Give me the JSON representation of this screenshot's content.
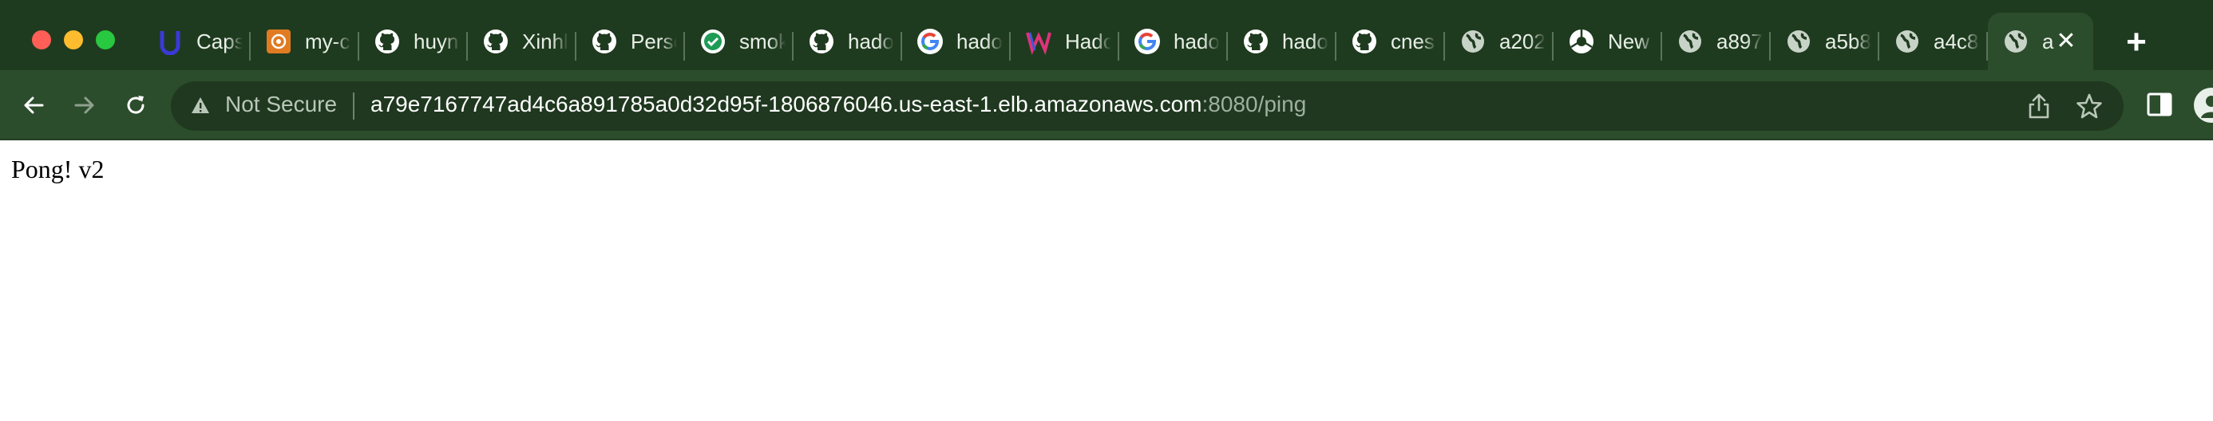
{
  "browser": {
    "tabs": [
      {
        "label": "Caps",
        "icon": "udacity-icon"
      },
      {
        "label": "my-c",
        "icon": "aws-orange-icon"
      },
      {
        "label": "huyn",
        "icon": "github-icon"
      },
      {
        "label": "Xinhl",
        "icon": "github-icon"
      },
      {
        "label": "Perso",
        "icon": "github-icon"
      },
      {
        "label": "smok",
        "icon": "green-check-icon"
      },
      {
        "label": "hado",
        "icon": "github-icon"
      },
      {
        "label": "hado",
        "icon": "google-icon"
      },
      {
        "label": "Hado",
        "icon": "w-logo-icon"
      },
      {
        "label": "hado",
        "icon": "google-icon"
      },
      {
        "label": "hado",
        "icon": "github-icon"
      },
      {
        "label": "cnes",
        "icon": "github-icon"
      },
      {
        "label": "a202",
        "icon": "globe-icon"
      },
      {
        "label": "New",
        "icon": "chrome-icon"
      },
      {
        "label": "a897",
        "icon": "globe-icon"
      },
      {
        "label": "a5b8",
        "icon": "globe-icon"
      },
      {
        "label": "a4c8",
        "icon": "globe-icon"
      }
    ],
    "active_tab": {
      "label": "a",
      "icon": "globe-icon"
    },
    "new_tab_label": "+",
    "close_label": "✕",
    "security_label": "Not Secure",
    "url_host": "a79e7167747ad4c6a891785a0d32d95f-1806876046.us-east-1.elb.amazonaws.com",
    "url_path": ":8080/ping",
    "colors": {
      "tabstrip": "#1f3b1f",
      "toolbar": "#2c4d2c",
      "omnibox": "#1f381f"
    }
  },
  "page": {
    "text": "Pong! v2"
  }
}
